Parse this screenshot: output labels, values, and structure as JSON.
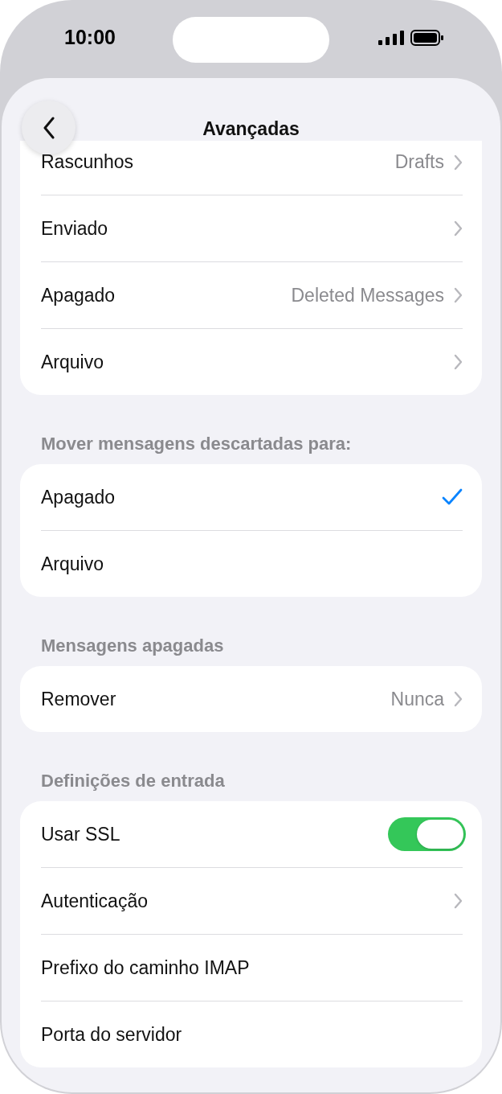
{
  "status_bar": {
    "time": "10:00"
  },
  "nav": {
    "title": "Avançadas"
  },
  "groups": [
    {
      "rows": [
        {
          "kind": "nav",
          "label": "Rascunhos",
          "value": "Drafts"
        },
        {
          "kind": "nav",
          "label": "Enviado"
        },
        {
          "kind": "nav",
          "label": "Apagado",
          "value": "Deleted Messages"
        },
        {
          "kind": "nav",
          "label": "Arquivo"
        }
      ]
    },
    {
      "header": "Mover mensagens descartadas para:",
      "rows": [
        {
          "kind": "check",
          "label": "Apagado",
          "selected": true
        },
        {
          "kind": "check",
          "label": "Arquivo",
          "selected": false
        }
      ]
    },
    {
      "header": "Mensagens apagadas",
      "rows": [
        {
          "kind": "nav",
          "label": "Remover",
          "value": "Nunca"
        }
      ]
    },
    {
      "header": "Definições de entrada",
      "rows": [
        {
          "kind": "toggle",
          "label": "Usar SSL",
          "on": true
        },
        {
          "kind": "nav",
          "label": "Autenticação"
        },
        {
          "kind": "plain",
          "label": "Prefixo do caminho IMAP"
        },
        {
          "kind": "plain",
          "label": "Porta do servidor"
        }
      ]
    }
  ]
}
